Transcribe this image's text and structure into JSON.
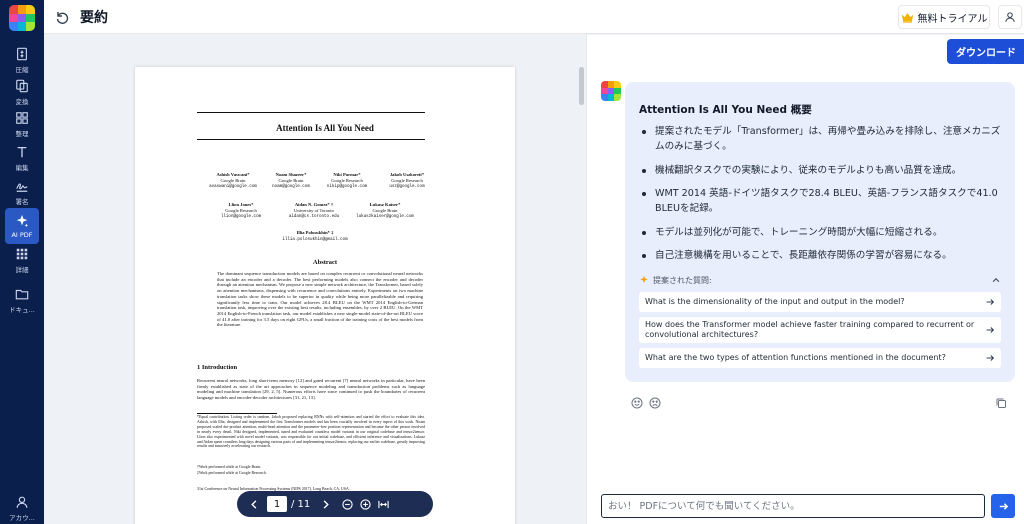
{
  "header": {
    "title": "要約",
    "trial_label": "無料トライアル"
  },
  "sidebar": {
    "items": [
      {
        "name": "compress",
        "label": "圧縮"
      },
      {
        "name": "convert",
        "label": "変換"
      },
      {
        "name": "organize",
        "label": "整理"
      },
      {
        "name": "edit",
        "label": "編集"
      },
      {
        "name": "sign",
        "label": "署名"
      },
      {
        "name": "ai-pdf",
        "label": "AI PDF"
      },
      {
        "name": "more",
        "label": "詳細"
      },
      {
        "name": "documents",
        "label": "ドキュ..."
      },
      {
        "name": "account",
        "label": "アカウ..."
      }
    ]
  },
  "pdf": {
    "title": "Attention Is All You Need",
    "authors": [
      {
        "name": "Ashish Vaswani*",
        "org": "Google Brain",
        "email": "avaswani@google.com"
      },
      {
        "name": "Noam Shazeer*",
        "org": "Google Brain",
        "email": "noam@google.com"
      },
      {
        "name": "Niki Parmar*",
        "org": "Google Research",
        "email": "nikip@google.com"
      },
      {
        "name": "Jakob Uszkoreit*",
        "org": "Google Research",
        "email": "usz@google.com"
      },
      {
        "name": "Llion Jones*",
        "org": "Google Research",
        "email": "llion@google.com"
      },
      {
        "name": "Aidan N. Gomez* †",
        "org": "University of Toronto",
        "email": "aidan@cs.toronto.edu"
      },
      {
        "name": "Łukasz Kaiser*",
        "org": "Google Brain",
        "email": "lukaszkaiser@google.com"
      },
      {
        "name": "Illia Polosukhin* ‡",
        "org": "",
        "email": "illia.polosukhin@gmail.com"
      }
    ],
    "abstract_title": "Abstract",
    "abstract": "The dominant sequence transduction models are based on complex recurrent or convolutional neural networks that include an encoder and a decoder. The best performing models also connect the encoder and decoder through an attention mechanism. We propose a new simple network architecture, the Transformer, based solely on attention mechanisms, dispensing with recurrence and convolutions entirely. Experiments on two machine translation tasks show these models to be superior in quality while being more parallelizable and requiring significantly less time to train. Our model achieves 28.4 BLEU on the WMT 2014 English-to-German translation task, improving over the existing best results, including ensembles, by over 2 BLEU. On the WMT 2014 English-to-French translation task, our model establishes a new single-model state-of-the-art BLEU score of 41.0 after training for 3.5 days on eight GPUs, a small fraction of the training costs of the best models from the literature.",
    "section_title": "1    Introduction",
    "intro": "Recurrent neural networks, long short-term memory [12] and gated recurrent [7] neural networks in particular, have been firmly established as state of the art approaches in sequence modeling and transduction problems such as language modeling and machine translation [29, 2, 5]. Numerous efforts have since continued to push the boundaries of recurrent language models and encoder-decoder architectures [31, 21, 13].",
    "footnote": "*Equal contribution. Listing order is random. Jakob proposed replacing RNNs with self-attention and started the effort to evaluate this idea. Ashish, with Illia, designed and implemented the first Transformer models and has been crucially involved in every aspect of this work. Noam proposed scaled dot-product attention, multi-head attention and the parameter-free position representation and became the other person involved in nearly every detail. Niki designed, implemented, tuned and evaluated countless model variants in our original codebase and tensor2tensor. Llion also experimented with novel model variants, was responsible for our initial codebase, and efficient inference and visualizations. Lukasz and Aidan spent countless long days designing various parts of and implementing tensor2tensor, replacing our earlier codebase, greatly improving results and massively accelerating our research.",
    "footnote_2": "†Work performed while at Google Brain.",
    "footnote_3": "‡Work performed while at Google Research.",
    "conference": "31st Conference on Neural Information Processing Systems (NIPS 2017), Long Beach, CA, USA."
  },
  "page_nav": {
    "current": "1",
    "total": "/ 11"
  },
  "panel": {
    "download_label": "ダウンロード",
    "summary_title": "Attention Is All You Need 概要",
    "summary_points": [
      "提案されたモデル「Transformer」は、再帰や畳み込みを排除し、注意メカニズムのみに基づく。",
      "機械翻訳タスクでの実験により、従来のモデルよりも高い品質を達成。",
      "WMT 2014 英語-ドイツ語タスクで28.4 BLEU、英語-フランス語タスクで41.0 BLEUを記録。",
      "モデルは並列化が可能で、トレーニング時間が大幅に短縮される。",
      "自己注意機構を用いることで、長距離依存関係の学習が容易になる。"
    ],
    "suggested_label": "提案された質問:",
    "questions": [
      "What is the dimensionality of the input and output in the model?",
      "How does the Transformer model achieve faster training compared to recurrent or convolutional architectures?",
      "What are the two types of attention functions mentioned in the document?"
    ],
    "input_placeholder": "おい！ PDFについて何でも聞いてください。"
  },
  "colors": {
    "sidebar_bg": "#0b1f4d",
    "accent": "#1d4ed8",
    "summary_bg": "#e8eefb"
  }
}
